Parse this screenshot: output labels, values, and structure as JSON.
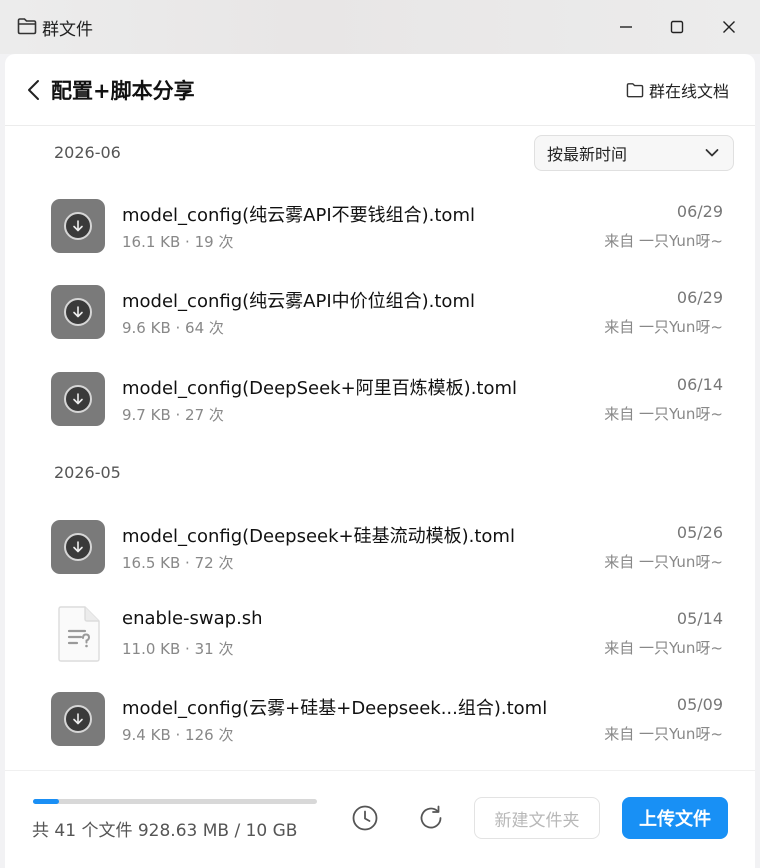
{
  "window": {
    "title": "群文件"
  },
  "header": {
    "title": "配置+脚本分享",
    "online_docs": "群在线文档"
  },
  "sort": {
    "selected": "按最新时间"
  },
  "groups": [
    {
      "label": "2026-06",
      "files": [
        {
          "name": "model_config(纯云雾API不要钱组合).toml",
          "meta": "16.1 KB · 19 次",
          "date": "06/29",
          "from": "来自 一只Yun呀~",
          "icon": "download-icon"
        },
        {
          "name": "model_config(纯云雾API中价位组合).toml",
          "meta": "9.6 KB · 64 次",
          "date": "06/29",
          "from": "来自 一只Yun呀~",
          "icon": "download-icon"
        },
        {
          "name": "model_config(DeepSeek+阿里百炼模板).toml",
          "meta": "9.7 KB · 27 次",
          "date": "06/14",
          "from": "来自 一只Yun呀~",
          "icon": "download-icon"
        }
      ]
    },
    {
      "label": "2026-05",
      "files": [
        {
          "name": "model_config(Deepseek+硅基流动模板).toml",
          "meta": "16.5 KB · 72 次",
          "date": "05/26",
          "from": "来自 一只Yun呀~",
          "icon": "download-icon"
        },
        {
          "name": "enable-swap.sh",
          "meta": "11.0 KB · 31 次",
          "date": "05/14",
          "from": "来自 一只Yun呀~",
          "icon": "unknown-file-icon"
        },
        {
          "name": "model_config(云雾+硅基+Deepseek...组合).toml",
          "meta": "9.4 KB · 126 次",
          "date": "05/09",
          "from": "来自 一只Yun呀~",
          "icon": "download-icon"
        }
      ]
    }
  ],
  "footer": {
    "storage_text": "共 41 个文件 928.63 MB / 10 GB",
    "usage_fraction": 0.09,
    "new_folder": "新建文件夹",
    "upload": "上传文件"
  },
  "colors": {
    "accent": "#1890f5",
    "icon_bg": "#7a7a7a"
  }
}
